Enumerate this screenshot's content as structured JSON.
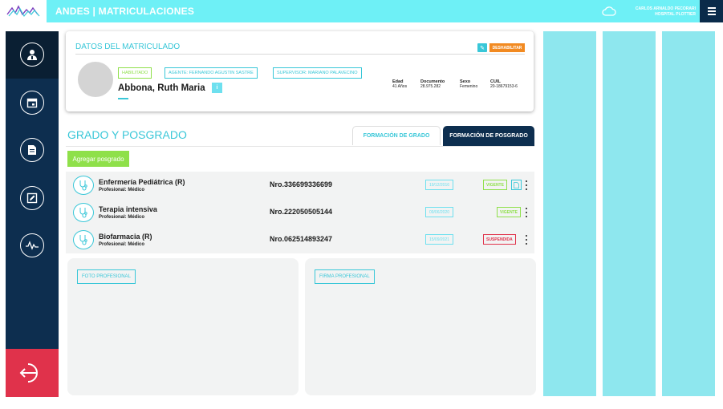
{
  "app": {
    "title": "ANDES | MATRICULACIONES",
    "user_name": "CARLOS ARNALDO PECORARI",
    "user_org": "HOSPITAL PLOTTIER"
  },
  "icons": {
    "logo": "andes-logo-wave",
    "cloud": "cloud-icon",
    "menu": "hamburger-menu-icon",
    "sidebar": [
      "doctor-icon",
      "calendar-icon",
      "document-icon",
      "edit-icon",
      "vital-signs-icon"
    ],
    "exit": "logout-icon"
  },
  "colors": {
    "topbar": "#6ef0f6",
    "navy": "#0d2e4f",
    "accent": "#39c7d8",
    "green": "#8fe04a",
    "orange": "#f28a21",
    "red": "#e0324b"
  },
  "header": {
    "title": "DATOS DEL MATRICULADO",
    "disable_label": "DESHABILITAR",
    "badges": {
      "status": "HABILITADO",
      "agent": "AGENTE: FERNANDO AGUSTIN SASTRE",
      "supervisor": "SUPERVISOR: MARIANO PALAVECINO"
    },
    "name": "Abbona, Ruth Maria",
    "stats": [
      {
        "label": "Edad",
        "value": "41 Años"
      },
      {
        "label": "Documento",
        "value": "28.975.282"
      },
      {
        "label": "Sexo",
        "value": "Femenino"
      },
      {
        "label": "CUIL",
        "value": "20-18679153-6"
      }
    ]
  },
  "grado": {
    "title": "GRADO Y POSGRADO",
    "tabs": [
      "FORMACIÓN DE GRADO",
      "FORMACIÓN DE POSGRADO"
    ],
    "active_tab": "FORMACIÓN DE POSGRADO",
    "add_label": "Agregar posgrado",
    "rows": [
      {
        "name": "Enfermería Pediátrica (R)",
        "sub": "Profesional: Médico",
        "number": "Nro.336699336699",
        "date": "19/12/2016",
        "status": "VIGENTE",
        "status_type": "green",
        "has_doc": true
      },
      {
        "name": "Terapia intensiva",
        "sub": "Profesional: Médico",
        "number": "Nro.222050505144",
        "date": "09/06/2020",
        "status": "VIGENTE",
        "status_type": "green",
        "has_doc": false
      },
      {
        "name": "Biofarmacia (R)",
        "sub": "Profesional: Médico",
        "number": "Nro.062514893247",
        "date": "15/09/2021",
        "status": "SUSPENDIDA",
        "status_type": "red",
        "has_doc": false
      }
    ]
  },
  "panels": {
    "photo_label": "FOTO PROFESIONAL",
    "signature_label": "FIRMA PROFESIONAL"
  }
}
